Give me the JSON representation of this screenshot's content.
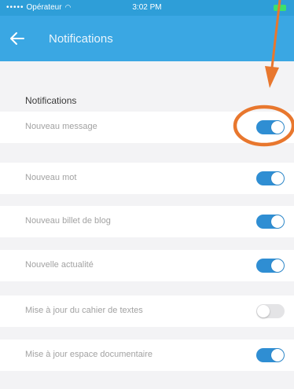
{
  "status_bar": {
    "carrier": "Opérateur",
    "time": "3:02 PM"
  },
  "nav": {
    "title": "Notifications"
  },
  "section": {
    "header": "Notifications"
  },
  "settings": [
    {
      "label": "Nouveau message",
      "enabled": true
    },
    {
      "label": "Nouveau mot",
      "enabled": true
    },
    {
      "label": "Nouveau billet de blog",
      "enabled": true
    },
    {
      "label": "Nouvelle actualité",
      "enabled": true
    },
    {
      "label": "Mise à jour du cahier de textes",
      "enabled": false
    },
    {
      "label": "Mise à jour espace documentaire",
      "enabled": true
    }
  ],
  "colors": {
    "nav_background": "#3aa7e3",
    "toggle_on": "#2f8ed3",
    "annotation": "#e8772e"
  }
}
